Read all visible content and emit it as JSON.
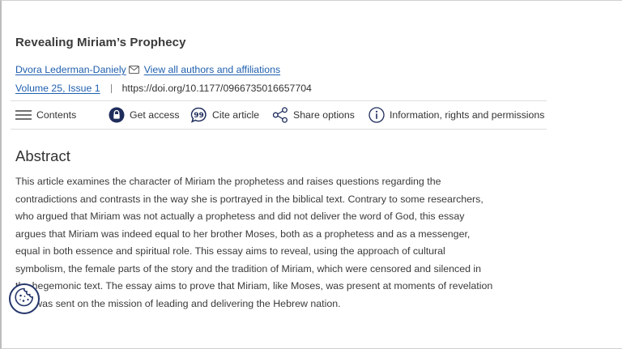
{
  "article": {
    "title": "Revealing Miriam’s Prophecy",
    "author": "Dvora Lederman-Daniely",
    "all_authors_link": "View all authors and affiliations",
    "volume_issue": "Volume 25, Issue 1",
    "doi": "https://doi.org/10.1177/0966735016657704"
  },
  "toolbar": {
    "contents": "Contents",
    "get_access": "Get access",
    "cite_article": "Cite article",
    "share_options": "Share options",
    "information": "Information, rights and permissions"
  },
  "abstract": {
    "heading": "Abstract",
    "lines": [
      "This article examines the character of Miriam the prophetess and raises questions regarding the",
      "contradictions and contrasts in the way she is portrayed in the biblical text. Contrary to some researchers,",
      "who argued that Miriam was not actually a prophetess and did not deliver the word of God, this essay",
      "argues that Miriam was indeed equal to her brother Moses, both as a prophetess and as a messenger,",
      "equal in both essence and spiritual role. This essay aims to reveal, using the approach of cultural",
      "symbolism, the female parts of the story and the tradition of Miriam, which were censored and silenced in",
      "the hegemonic text. The essay aims to prove that Miriam, like Moses, was present at moments of revelation",
      "and was sent on the mission of leading and delivering the Hebrew nation."
    ]
  },
  "icons": {
    "mail": "mail-icon",
    "contents": "hamburger-icon",
    "get_access": "lock-icon",
    "cite": "quote-icon",
    "share": "share-icon",
    "info": "info-icon",
    "cookie": "cookie-icon"
  },
  "colors": {
    "link": "#1f5fae",
    "accent_dark": "#25356b",
    "text": "#333333"
  }
}
